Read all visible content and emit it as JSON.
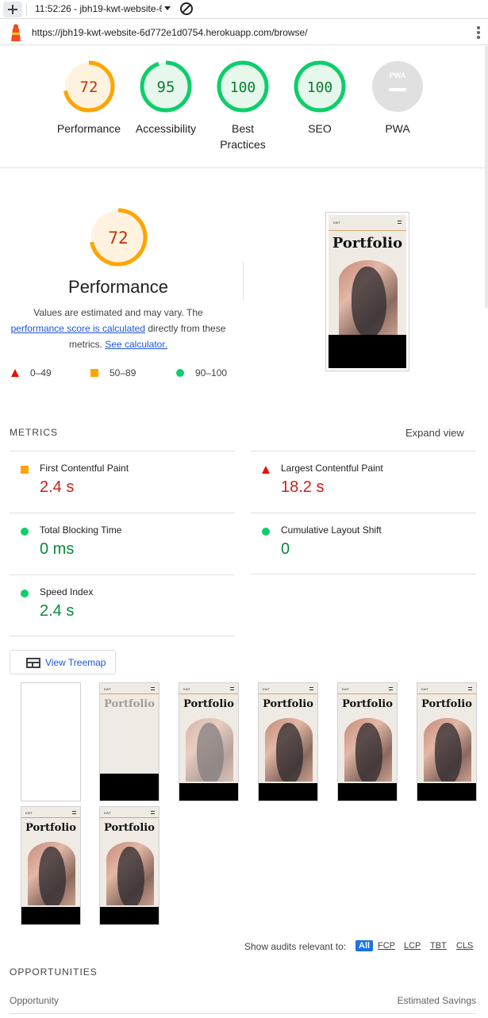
{
  "tab": {
    "title": "11:52:26 - jbh19-kwt-website-6",
    "new_tab_icon": "plus-icon",
    "blocked_icon": "block-icon"
  },
  "urlbar": {
    "url": "https://jbh19-kwt-website-6d772e1d0754.herokuapp.com/browse/",
    "logo_icon": "lighthouse-icon",
    "menu_icon": "kebab-menu-icon"
  },
  "categories": [
    {
      "score": "72",
      "label": "Performance",
      "level": "average",
      "value": 72
    },
    {
      "score": "95",
      "label": "Accessibility",
      "level": "pass",
      "value": 95
    },
    {
      "score": "100",
      "label": "Best Practices",
      "level": "pass",
      "value": 100
    },
    {
      "score": "100",
      "label": "SEO",
      "level": "pass",
      "value": 100
    },
    {
      "score": "PWA",
      "label": "PWA",
      "level": "na",
      "value": 0
    }
  ],
  "performance": {
    "score": "72",
    "value": 72,
    "title": "Performance",
    "desc_prefix": "Values are estimated and may vary. The ",
    "desc_link": "performance score is calculated",
    "desc_mid": " directly from these metrics. ",
    "desc_link2": "See calculator.",
    "legend": [
      {
        "range": "0–49",
        "shape": "triangle"
      },
      {
        "range": "50–89",
        "shape": "square"
      },
      {
        "range": "90–100",
        "shape": "circle"
      }
    ]
  },
  "screenshot": {
    "brand": "KWT",
    "title": "Portfolio"
  },
  "metrics": {
    "header": "METRICS",
    "expand": "Expand view",
    "items": [
      {
        "name": "First Contentful Paint",
        "value": "2.4 s",
        "level": "average"
      },
      {
        "name": "Largest Contentful Paint",
        "value": "18.2 s",
        "level": "fail"
      },
      {
        "name": "Total Blocking Time",
        "value": "0 ms",
        "level": "pass"
      },
      {
        "name": "Cumulative Layout Shift",
        "value": "0",
        "level": "pass"
      },
      {
        "name": "Speed Index",
        "value": "2.4 s",
        "level": "pass"
      }
    ]
  },
  "treemap": {
    "label": "View Treemap",
    "icon": "treemap-icon"
  },
  "filmstrip": [
    {
      "state": "blank"
    },
    {
      "state": "title-faded"
    },
    {
      "state": "full-faded"
    },
    {
      "state": "full"
    },
    {
      "state": "full"
    },
    {
      "state": "full"
    },
    {
      "state": "full"
    },
    {
      "state": "full"
    }
  ],
  "audits_filter": {
    "label": "Show audits relevant to:",
    "chips": [
      "All",
      "FCP",
      "LCP",
      "TBT",
      "CLS"
    ],
    "active": "All"
  },
  "opportunities": {
    "header": "OPPORTUNITIES",
    "col_left": "Opportunity",
    "col_right": "Estimated Savings"
  },
  "colors": {
    "fail": "#eb0f00",
    "average": "#ffa400",
    "pass": "#0cce6b",
    "link": "#1a57d6"
  }
}
